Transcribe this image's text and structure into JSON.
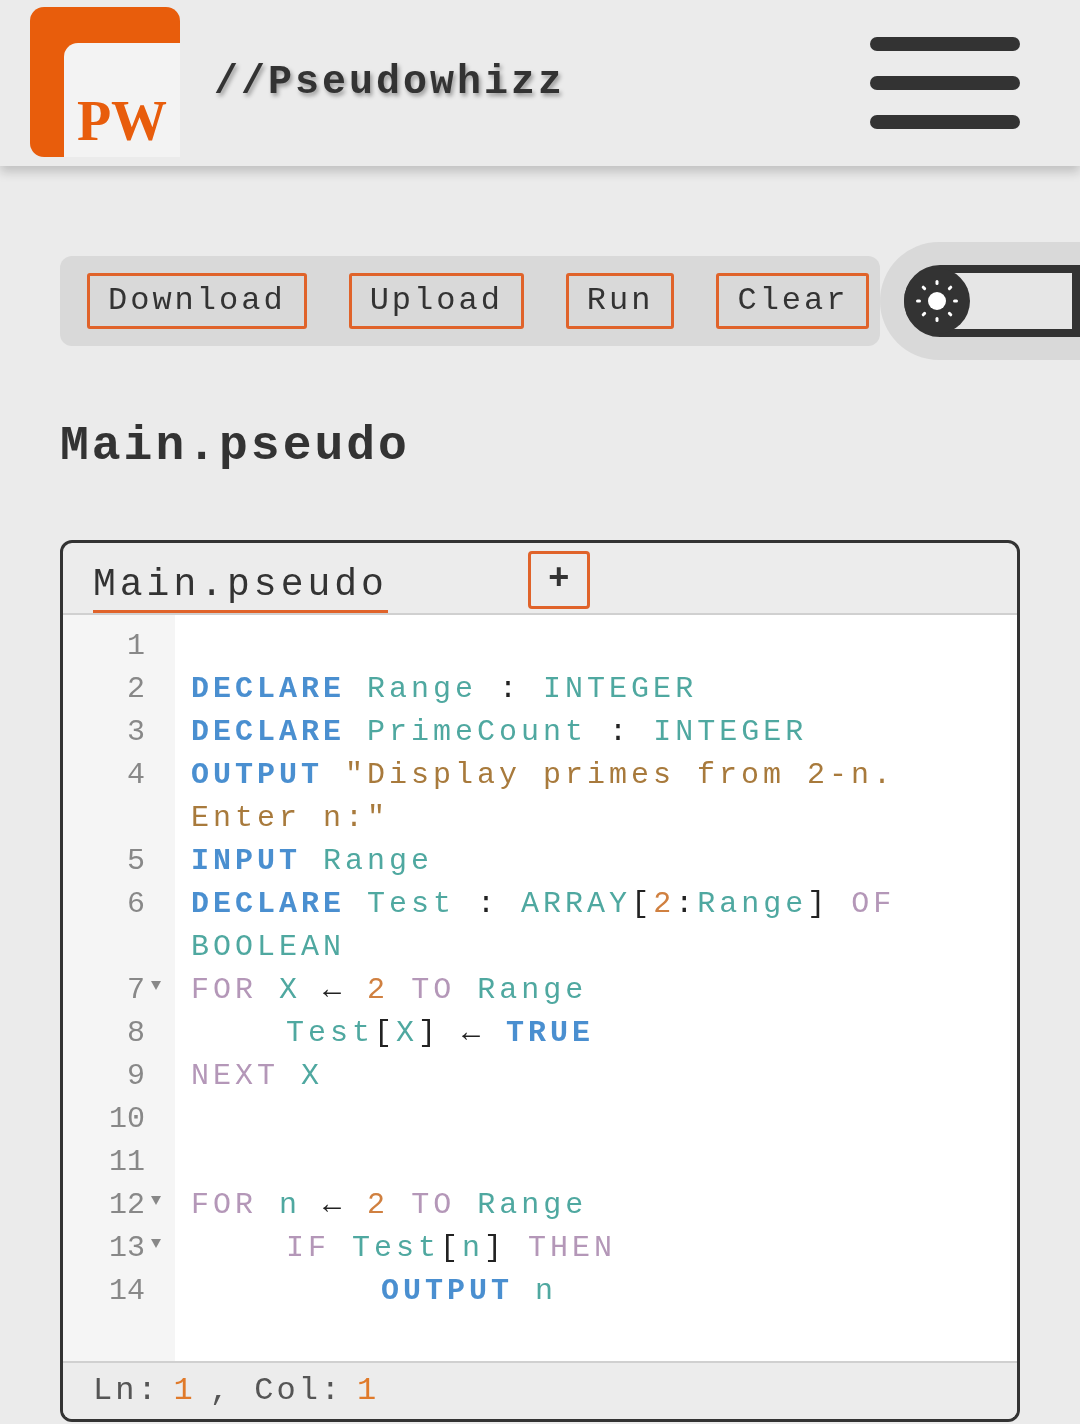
{
  "header": {
    "logo_text": "PW",
    "title": "//Pseudowhizz"
  },
  "toolbar": {
    "buttons": [
      "Download",
      "Upload",
      "Run",
      "Clear"
    ],
    "theme_toggle": {
      "on": false
    }
  },
  "file_title": "Main.pseudo",
  "editor": {
    "tabs": [
      {
        "label": "Main.pseudo",
        "selected": true
      }
    ],
    "add_tab": "+",
    "lines": [
      {
        "number": "1"
      },
      {
        "number": "2",
        "tokens": [
          {
            "text": "DECLARE",
            "kind": "keyword"
          },
          {
            "text": "Range",
            "kind": "ident"
          },
          {
            "text": ":",
            "kind": "op"
          },
          {
            "text": "INTEGER",
            "kind": "type"
          }
        ]
      },
      {
        "number": "3",
        "tokens": [
          {
            "text": "DECLARE",
            "kind": "keyword"
          },
          {
            "text": "PrimeCount",
            "kind": "ident"
          },
          {
            "text": ":",
            "kind": "op"
          },
          {
            "text": "INTEGER",
            "kind": "type"
          }
        ]
      },
      {
        "number": "4",
        "tokens": [
          {
            "text": "OUTPUT",
            "kind": "keyword"
          },
          {
            "text": "\"Display primes from 2-n.",
            "kind": "string"
          },
          {
            "text": "Enter n:\"",
            "kind": "string"
          }
        ]
      },
      {
        "number": "5",
        "tokens": [
          {
            "text": "INPUT",
            "kind": "keyword"
          },
          {
            "text": "Range",
            "kind": "ident"
          }
        ]
      },
      {
        "number": "6",
        "tokens": [
          {
            "text": "DECLARE",
            "kind": "keyword"
          },
          {
            "text": "Test",
            "kind": "ident"
          },
          {
            "text": ":",
            "kind": "op"
          },
          {
            "text": "ARRAY",
            "kind": "type"
          },
          {
            "text": "[",
            "kind": "op"
          },
          {
            "text": "2",
            "kind": "number"
          },
          {
            "text": ":",
            "kind": "op"
          },
          {
            "text": "Range",
            "kind": "ident"
          },
          {
            "text": "]",
            "kind": "op"
          },
          {
            "text": "OF",
            "kind": "control"
          },
          {
            "text": "BOOLEAN",
            "kind": "type"
          }
        ]
      },
      {
        "number": "7",
        "tokens": [
          {
            "text": "FOR",
            "kind": "control"
          },
          {
            "text": "X",
            "kind": "ident"
          },
          {
            "text": "←",
            "kind": "op"
          },
          {
            "text": "2",
            "kind": "number"
          },
          {
            "text": "TO",
            "kind": "control"
          },
          {
            "text": "Range",
            "kind": "ident"
          }
        ],
        "children": [
          {
            "number": "8",
            "tokens": [
              {
                "text": "Test",
                "kind": "ident"
              },
              {
                "text": "[",
                "kind": "op"
              },
              {
                "text": "X",
                "kind": "ident"
              },
              {
                "text": "]",
                "kind": "op"
              },
              {
                "text": "←",
                "kind": "op"
              },
              {
                "text": "TRUE",
                "kind": "keyword"
              }
            ]
          }
        ]
      },
      {
        "number": "9",
        "tokens": [
          {
            "text": "NEXT",
            "kind": "control"
          },
          {
            "text": "X",
            "kind": "ident"
          }
        ]
      },
      {
        "number": "10"
      },
      {
        "number": "11"
      },
      {
        "number": "12",
        "tokens": [
          {
            "text": "FOR",
            "kind": "control"
          },
          {
            "text": "n",
            "kind": "ident"
          },
          {
            "text": "←",
            "kind": "op"
          },
          {
            "text": "2",
            "kind": "number"
          },
          {
            "text": "TO",
            "kind": "control"
          },
          {
            "text": "Range",
            "kind": "ident"
          }
        ],
        "children": [
          {
            "number": "13",
            "tokens": [
              {
                "text": "IF",
                "kind": "control"
              },
              {
                "text": "Test",
                "kind": "ident"
              },
              {
                "text": "[",
                "kind": "op"
              },
              {
                "text": "n",
                "kind": "ident"
              },
              {
                "text": "]",
                "kind": "op"
              },
              {
                "text": "THEN",
                "kind": "control"
              }
            ],
            "children": [
              {
                "number": "14",
                "tokens": [
                  {
                    "text": "OUTPUT",
                    "kind": "keyword"
                  },
                  {
                    "text": "n",
                    "kind": "ident"
                  }
                ]
              }
            ]
          }
        ]
      }
    ]
  },
  "status_bar": {
    "ln_label": "Ln:",
    "ln": "1",
    "col_label": ", Col:",
    "col": "1"
  }
}
